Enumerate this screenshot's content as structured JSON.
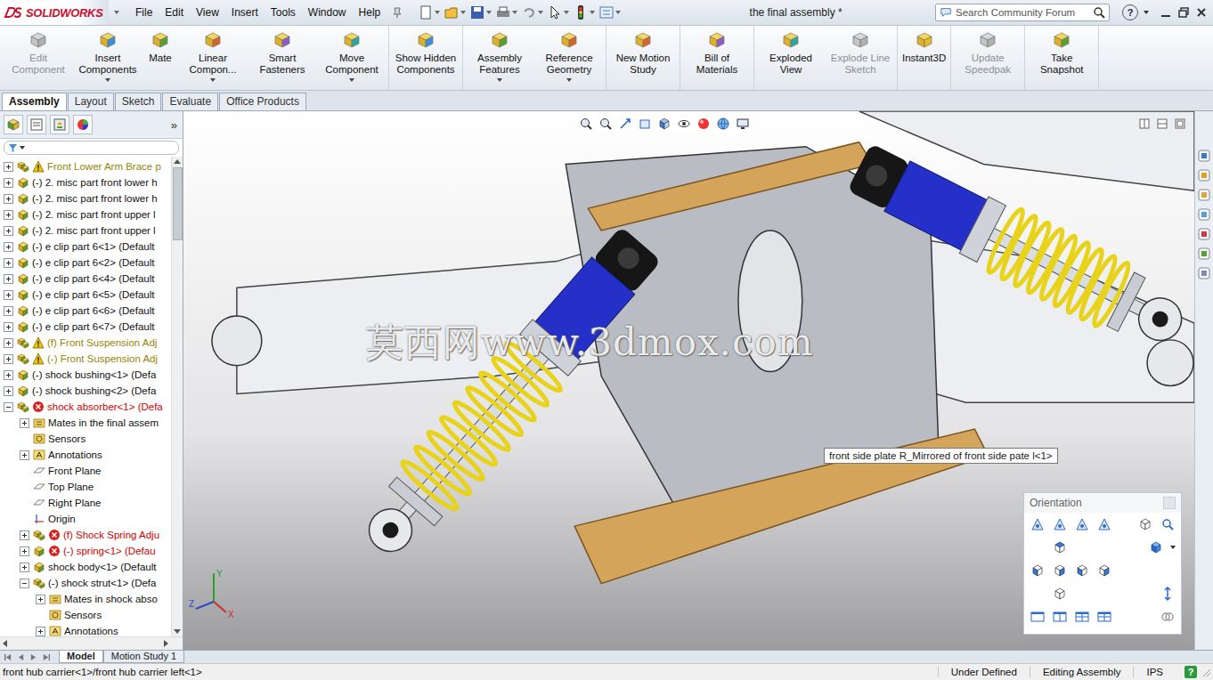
{
  "app": {
    "logo": "SOLIDWORKS",
    "title": "the final assembly *"
  },
  "menu": [
    "File",
    "Edit",
    "View",
    "Insert",
    "Tools",
    "Window",
    "Help"
  ],
  "search": {
    "placeholder": "Search Community Forum"
  },
  "help": "?",
  "ribbon": {
    "groups": [
      [
        {
          "label": "Edit Component",
          "disabled": true,
          "dropdown": false
        },
        {
          "label": "Insert Components",
          "disabled": false,
          "dropdown": true
        },
        {
          "label": "Mate",
          "disabled": false,
          "dropdown": false
        },
        {
          "label": "Linear Compon...",
          "disabled": false,
          "dropdown": true
        },
        {
          "label": "Smart Fasteners",
          "disabled": false,
          "dropdown": false
        },
        {
          "label": "Move Component",
          "disabled": false,
          "dropdown": true
        }
      ],
      [
        {
          "label": "Show Hidden Components",
          "disabled": false,
          "dropdown": false
        }
      ],
      [
        {
          "label": "Assembly Features",
          "disabled": false,
          "dropdown": true
        },
        {
          "label": "Reference Geometry",
          "disabled": false,
          "dropdown": true
        }
      ],
      [
        {
          "label": "New Motion Study",
          "disabled": false,
          "dropdown": false
        }
      ],
      [
        {
          "label": "Bill of Materials",
          "disabled": false,
          "dropdown": false
        }
      ],
      [
        {
          "label": "Exploded View",
          "disabled": false,
          "dropdown": false
        },
        {
          "label": "Explode Line Sketch",
          "disabled": true,
          "dropdown": false
        }
      ],
      [
        {
          "label": "Instant3D",
          "disabled": false,
          "dropdown": false
        }
      ],
      [
        {
          "label": "Update Speedpak",
          "disabled": true,
          "dropdown": false
        }
      ],
      [
        {
          "label": "Take Snapshot",
          "disabled": false,
          "dropdown": false
        }
      ]
    ]
  },
  "command_tabs": [
    {
      "label": "Assembly",
      "selected": true
    },
    {
      "label": "Layout",
      "selected": false
    },
    {
      "label": "Sketch",
      "selected": false
    },
    {
      "label": "Evaluate",
      "selected": false
    },
    {
      "label": "Office Products",
      "selected": false
    }
  ],
  "feature_tree": {
    "more": "»",
    "items": [
      {
        "label": "Front Lower Arm Brace p",
        "level": 0,
        "expandable": true,
        "expanded": false,
        "kind": "assembly",
        "status": "warning"
      },
      {
        "label": "(-) 2. misc part front lower h",
        "level": 0,
        "expandable": true,
        "expanded": false,
        "kind": "part",
        "status": "ok"
      },
      {
        "label": "(-) 2. misc part front lower h",
        "level": 0,
        "expandable": true,
        "expanded": false,
        "kind": "part",
        "status": "ok"
      },
      {
        "label": "(-) 2. misc part front upper l",
        "level": 0,
        "expandable": true,
        "expanded": false,
        "kind": "part",
        "status": "ok"
      },
      {
        "label": "(-) 2. misc part front upper l",
        "level": 0,
        "expandable": true,
        "expanded": false,
        "kind": "part",
        "status": "ok"
      },
      {
        "label": "(-) e clip part 6<1> (Default",
        "level": 0,
        "expandable": true,
        "expanded": false,
        "kind": "part",
        "status": "ok"
      },
      {
        "label": "(-) e clip part 6<2> (Default",
        "level": 0,
        "expandable": true,
        "expanded": false,
        "kind": "part",
        "status": "ok"
      },
      {
        "label": "(-) e clip part 6<4> (Default",
        "level": 0,
        "expandable": true,
        "expanded": false,
        "kind": "part",
        "status": "ok"
      },
      {
        "label": "(-) e clip part 6<5> (Default",
        "level": 0,
        "expandable": true,
        "expanded": false,
        "kind": "part",
        "status": "ok"
      },
      {
        "label": "(-) e clip part 6<6> (Default",
        "level": 0,
        "expandable": true,
        "expanded": false,
        "kind": "part",
        "status": "ok"
      },
      {
        "label": "(-) e clip part 6<7> (Default",
        "level": 0,
        "expandable": true,
        "expanded": false,
        "kind": "part",
        "status": "ok"
      },
      {
        "label": "(f) Front Suspension Adj",
        "level": 0,
        "expandable": true,
        "expanded": false,
        "kind": "assembly",
        "status": "warning"
      },
      {
        "label": "(-) Front Suspension Adj",
        "level": 0,
        "expandable": true,
        "expanded": false,
        "kind": "assembly",
        "status": "warning"
      },
      {
        "label": "(-) shock bushing<1> (Defa",
        "level": 0,
        "expandable": true,
        "expanded": false,
        "kind": "part",
        "status": "ok"
      },
      {
        "label": "(-) shock bushing<2> (Defa",
        "level": 0,
        "expandable": true,
        "expanded": false,
        "kind": "part",
        "status": "ok"
      },
      {
        "label": "shock absorber<1> (Defa",
        "level": 0,
        "expandable": true,
        "expanded": true,
        "kind": "assembly",
        "status": "error"
      },
      {
        "label": "Mates in the final assem",
        "level": 1,
        "expandable": true,
        "expanded": false,
        "kind": "mates",
        "status": "ok"
      },
      {
        "label": "Sensors",
        "level": 1,
        "expandable": false,
        "expanded": false,
        "kind": "sensors",
        "status": "ok"
      },
      {
        "label": "Annotations",
        "level": 1,
        "expandable": true,
        "expanded": false,
        "kind": "annotations",
        "status": "ok"
      },
      {
        "label": "Front Plane",
        "level": 1,
        "expandable": false,
        "expanded": false,
        "kind": "plane",
        "status": "ok"
      },
      {
        "label": "Top Plane",
        "level": 1,
        "expandable": false,
        "expanded": false,
        "kind": "plane",
        "status": "ok"
      },
      {
        "label": "Right Plane",
        "level": 1,
        "expandable": false,
        "expanded": false,
        "kind": "plane",
        "status": "ok"
      },
      {
        "label": "Origin",
        "level": 1,
        "expandable": false,
        "expanded": false,
        "kind": "origin",
        "status": "ok"
      },
      {
        "label": "(f) Shock Spring Adju",
        "level": 1,
        "expandable": true,
        "expanded": false,
        "kind": "assembly",
        "status": "error"
      },
      {
        "label": "(-) spring<1> (Defau",
        "level": 1,
        "expandable": true,
        "expanded": false,
        "kind": "part",
        "status": "error"
      },
      {
        "label": "shock body<1> (Default",
        "level": 1,
        "expandable": true,
        "expanded": false,
        "kind": "part",
        "status": "ok"
      },
      {
        "label": "(-) shock strut<1> (Defa",
        "level": 1,
        "expandable": true,
        "expanded": true,
        "kind": "assembly",
        "status": "ok"
      },
      {
        "label": "Mates in shock abso",
        "level": 2,
        "expandable": true,
        "expanded": false,
        "kind": "mates",
        "status": "ok"
      },
      {
        "label": "Sensors",
        "level": 2,
        "expandable": false,
        "expanded": false,
        "kind": "sensors",
        "status": "ok"
      },
      {
        "label": "Annotations",
        "level": 2,
        "expandable": true,
        "expanded": false,
        "kind": "annotations",
        "status": "ok"
      }
    ]
  },
  "viewport": {
    "watermark": "莫西网www.3dmox.com",
    "tooltip": "front side plate R_Mirrored of front side pate l<1>",
    "triad": [
      "Y",
      "Z",
      "X"
    ]
  },
  "orientation": {
    "title": "Orientation"
  },
  "bottom_tabs": [
    {
      "label": "Model",
      "selected": true
    },
    {
      "label": "Motion Study 1",
      "selected": false
    }
  ],
  "status_bar": {
    "path": "front hub carrier<1>/front hub carrier left<1>",
    "items": [
      "Under Defined",
      "Editing Assembly",
      "IPS"
    ],
    "help": "?"
  }
}
